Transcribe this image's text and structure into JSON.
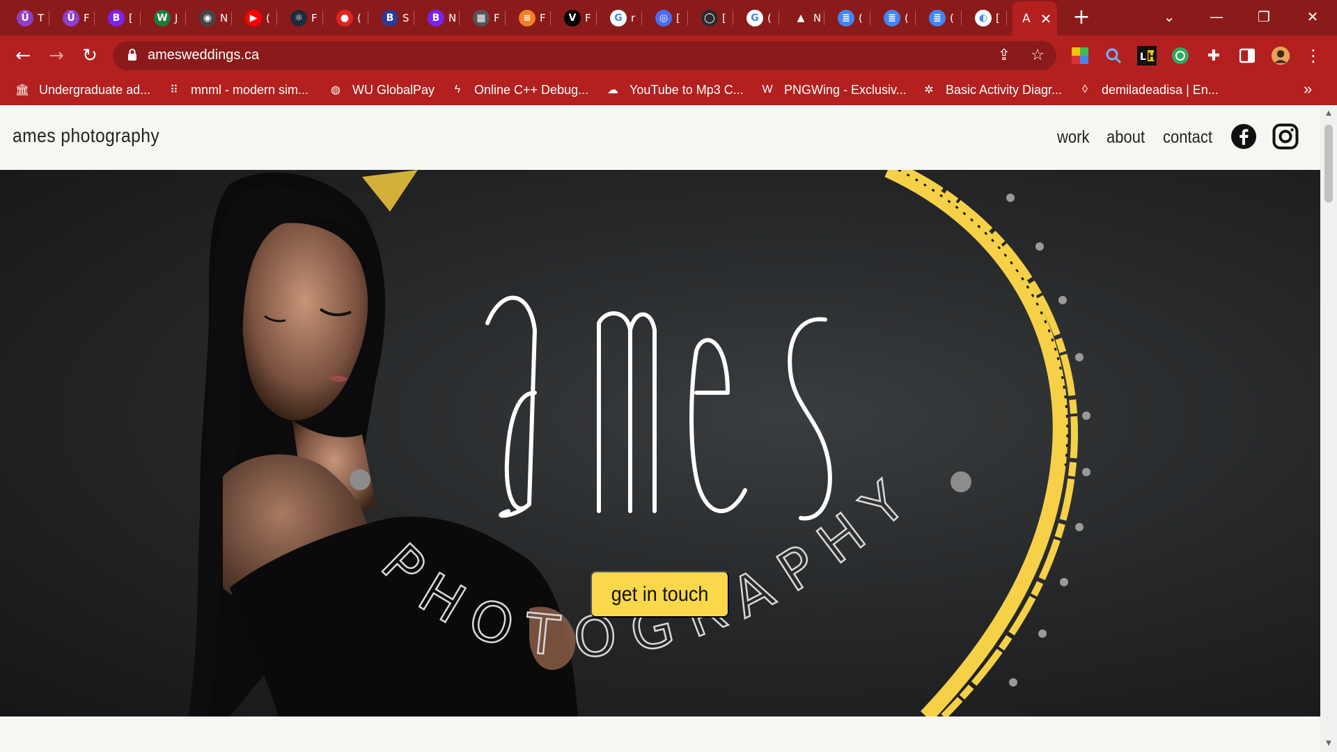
{
  "tabs": [
    {
      "favicon": "u-logo-icon",
      "letter": "T",
      "color": "#8e3ec8",
      "glyph": "Ü"
    },
    {
      "favicon": "u-logo-icon",
      "letter": "F",
      "color": "#8e3ec8",
      "glyph": "Ü"
    },
    {
      "favicon": "bootstrap-icon",
      "letter": "[",
      "color": "#7a21f5",
      "glyph": "B"
    },
    {
      "favicon": "w-logo-icon",
      "letter": "J",
      "color": "#1a7a3a",
      "glyph": "W"
    },
    {
      "favicon": "chromium-icon",
      "letter": "N",
      "color": "#444",
      "glyph": "◉"
    },
    {
      "favicon": "youtube-icon",
      "letter": "(",
      "color": "#ff0000",
      "glyph": "▶"
    },
    {
      "favicon": "react-icon",
      "letter": "F",
      "color": "#1c2a3a",
      "glyph": "⚛"
    },
    {
      "favicon": "circle-red-icon",
      "letter": "(",
      "color": "#e0241f",
      "glyph": "●"
    },
    {
      "favicon": "bootstrap-icon",
      "letter": "S",
      "color": "#2a3c96",
      "glyph": "B"
    },
    {
      "favicon": "bootstrap-icon",
      "letter": "N",
      "color": "#7a21f5",
      "glyph": "B"
    },
    {
      "favicon": "store-icon",
      "letter": "F",
      "color": "#555",
      "glyph": "▦"
    },
    {
      "favicon": "stackoverflow-icon",
      "letter": "F",
      "color": "#f48024",
      "glyph": "≡"
    },
    {
      "favicon": "v-logo-icon",
      "letter": "F",
      "color": "#000",
      "glyph": "V"
    },
    {
      "favicon": "google-icon",
      "letter": "r",
      "color": "#ffffff",
      "glyph": "G"
    },
    {
      "favicon": "circle-blue-icon",
      "letter": "[",
      "color": "#4a6cf7",
      "glyph": "◎"
    },
    {
      "favicon": "github-icon",
      "letter": "[",
      "color": "#2b2b2b",
      "glyph": "◯"
    },
    {
      "favicon": "google-icon",
      "letter": "(",
      "color": "#ffffff",
      "glyph": "G"
    },
    {
      "favicon": "google-drive-icon",
      "letter": "N",
      "color": "#8b1a1a",
      "glyph": "▲"
    },
    {
      "favicon": "google-docs-icon",
      "letter": "(",
      "color": "#4285f4",
      "glyph": "≣"
    },
    {
      "favicon": "google-docs-icon",
      "letter": "(",
      "color": "#4285f4",
      "glyph": "≣"
    },
    {
      "favicon": "google-docs-icon",
      "letter": "(",
      "color": "#4285f4",
      "glyph": "≣"
    },
    {
      "favicon": "globe-icon",
      "letter": "[",
      "color": "#ffffff",
      "glyph": "◐"
    }
  ],
  "active_tab": {
    "letter": "A",
    "close": "✕"
  },
  "new_tab": "+",
  "window_controls": {
    "tabsearch": "⌄",
    "minimize": "—",
    "restore": "❐",
    "close": "✕"
  },
  "toolbar": {
    "back": "←",
    "forward": "→",
    "reload": "↻",
    "url": "amesweddings.ca",
    "share": "⇪",
    "bookmark_star": "☆",
    "menu": "⋮"
  },
  "bookmarks": [
    {
      "icon": "building-icon",
      "glyph": "🏛",
      "label": "Undergraduate ad..."
    },
    {
      "icon": "mnml-icon",
      "glyph": "⠿",
      "label": "mnml - modern sim..."
    },
    {
      "icon": "globe-icon",
      "glyph": "◍",
      "label": "WU GlobalPay"
    },
    {
      "icon": "lightning-icon",
      "glyph": "ϟ",
      "label": "Online C++ Debug..."
    },
    {
      "icon": "download-cloud-icon",
      "glyph": "☁",
      "label": "YouTube to Mp3 C..."
    },
    {
      "icon": "pngwing-icon",
      "glyph": "W",
      "label": "PNGWing - Exclusiv..."
    },
    {
      "icon": "diagram-icon",
      "glyph": "✲",
      "label": "Basic Activity Diagr..."
    },
    {
      "icon": "drop-icon",
      "glyph": "◊",
      "label": "demiladeadisa | En..."
    }
  ],
  "bookmarks_overflow": "»",
  "site": {
    "brand": "ames photography",
    "nav": [
      "work",
      "about",
      "contact"
    ],
    "cta": "get in touch",
    "hero_word": "ames",
    "hero_arc_word": "PHOTOGRAPHY",
    "accent_color": "#fbd84a"
  }
}
